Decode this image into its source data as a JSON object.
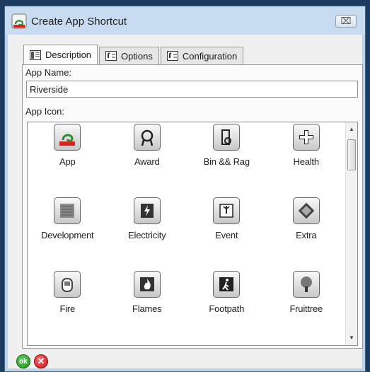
{
  "window": {
    "title": "Create App Shortcut",
    "close_glyph": "⌧"
  },
  "tabs": [
    {
      "label": "Description",
      "icon": "description-tab-icon"
    },
    {
      "label": "Options",
      "icon": "options-tab-icon"
    },
    {
      "label": "Configuration",
      "icon": "configuration-tab-icon"
    }
  ],
  "form": {
    "app_name_label": "App Name:",
    "app_name_value": "Riverside",
    "app_icon_label": "App Icon:"
  },
  "icons": [
    {
      "label": "App",
      "icon": "app-icon"
    },
    {
      "label": "Award",
      "icon": "award-icon"
    },
    {
      "label": "Bin && Rag",
      "icon": "bin-rag-icon"
    },
    {
      "label": "Health",
      "icon": "health-icon"
    },
    {
      "label": "Development",
      "icon": "development-icon"
    },
    {
      "label": "Electricity",
      "icon": "electricity-icon"
    },
    {
      "label": "Event",
      "icon": "event-icon"
    },
    {
      "label": "Extra",
      "icon": "extra-icon"
    },
    {
      "label": "Fire",
      "icon": "fire-icon"
    },
    {
      "label": "Flames",
      "icon": "flames-icon"
    },
    {
      "label": "Footpath",
      "icon": "footpath-icon"
    },
    {
      "label": "Fruittree",
      "icon": "fruittree-icon"
    }
  ],
  "buttons": {
    "ok_label": "ok",
    "cancel_label": "✕"
  },
  "scrollbar": {
    "up": "▲",
    "down": "▼"
  }
}
